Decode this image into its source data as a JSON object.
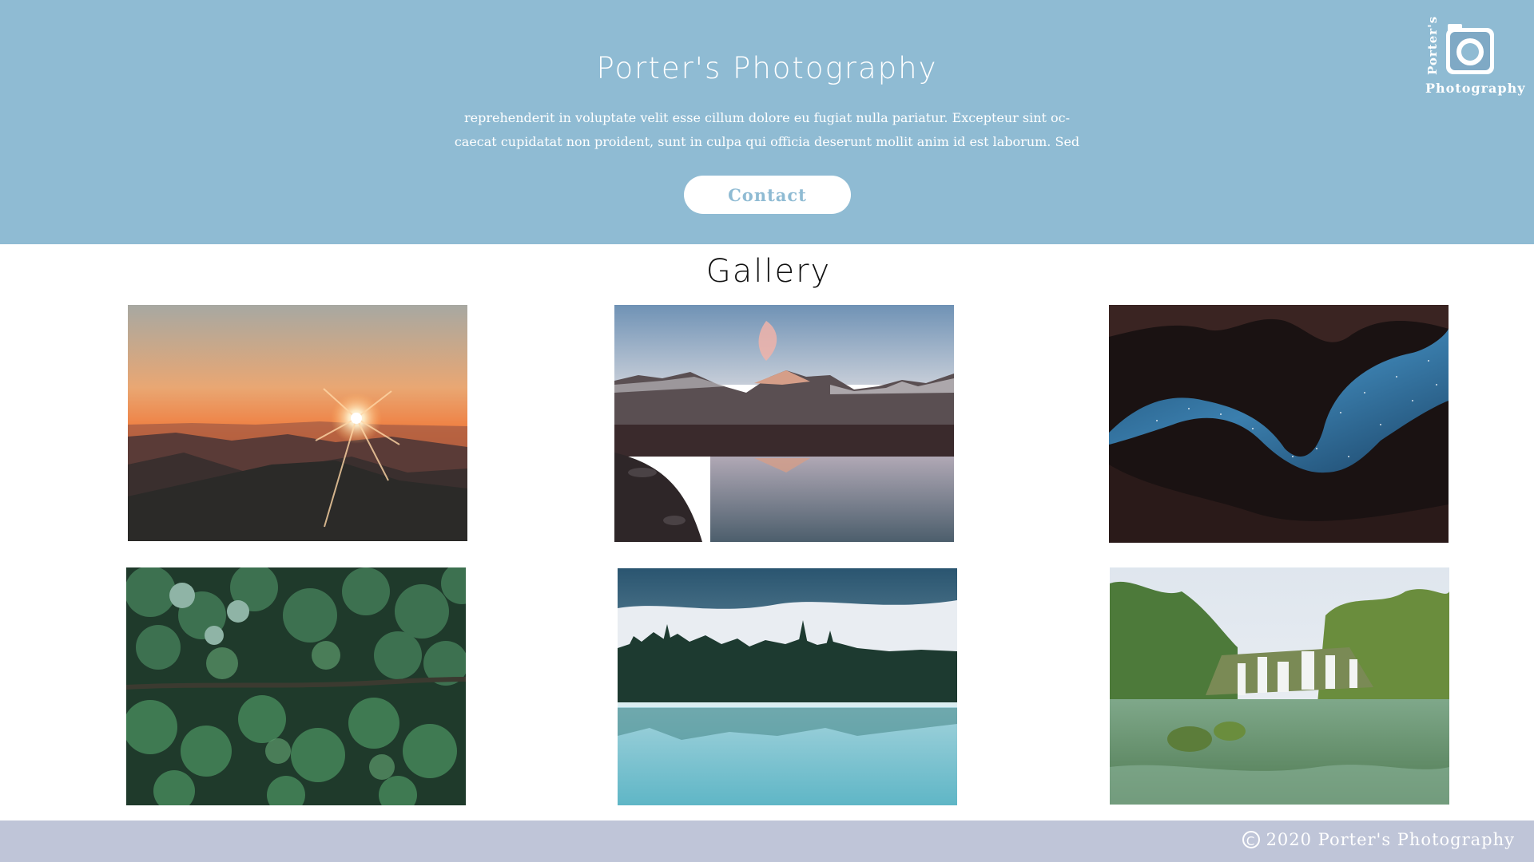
{
  "header": {
    "title": "Porter's Photography",
    "description_lines": [
      "reprehenderit in voluptate velit esse cillum dolore eu fugiat nulla pariatur. Excepteur sint oc-",
      "caecat cupidatat non proident, sunt in culpa qui officia deserunt mollit anim id est laborum. Sed"
    ],
    "contact_label": "Contact",
    "background_color": "#8fbbd3"
  },
  "logo": {
    "vertical_text": "Porter's",
    "horizontal_text": "Photography",
    "icon": "camera-icon"
  },
  "gallery": {
    "title": "Gallery",
    "photos": [
      {
        "name": "sunset-mountains-photo"
      },
      {
        "name": "mountain-lake-reflection-photo"
      },
      {
        "name": "canyon-night-sky-photo"
      },
      {
        "name": "forest-aerial-photo"
      },
      {
        "name": "misty-lake-forest-photo"
      },
      {
        "name": "waterfall-lagoon-photo"
      }
    ]
  },
  "footer": {
    "copyright_symbol": "C",
    "copyright_text": "2020 Porter's Photography",
    "background_color": "#bfc5d8"
  }
}
